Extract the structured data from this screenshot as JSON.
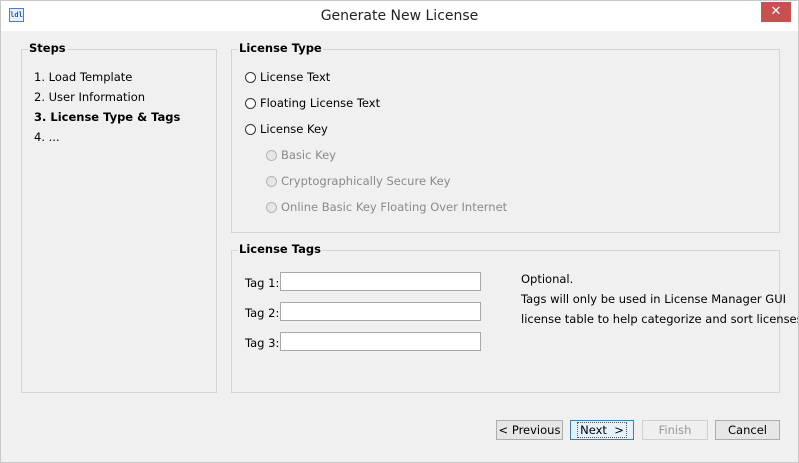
{
  "window": {
    "title": "Generate New License",
    "icon": "app-icon",
    "icon_text": "ldl",
    "close_label": "✕"
  },
  "steps": {
    "title": "Steps",
    "items": [
      "1. Load Template",
      "2. User Information",
      "3. License Type & Tags",
      "4. ..."
    ],
    "active_index": 2
  },
  "license_type": {
    "title": "License Type",
    "options": [
      {
        "label": "License Text",
        "enabled": true,
        "selected": false
      },
      {
        "label": "Floating License Text",
        "enabled": true,
        "selected": false
      },
      {
        "label": "License Key",
        "enabled": true,
        "selected": false
      }
    ],
    "key_options": [
      {
        "label": "Basic Key",
        "enabled": false,
        "selected": false
      },
      {
        "label": "Cryptographically Secure Key",
        "enabled": false,
        "selected": false
      },
      {
        "label": "Online Basic Key Floating Over Internet",
        "enabled": false,
        "selected": false
      }
    ]
  },
  "license_tags": {
    "title": "License Tags",
    "tags": [
      {
        "label": "Tag 1:",
        "value": ""
      },
      {
        "label": "Tag 2:",
        "value": ""
      },
      {
        "label": "Tag 3:",
        "value": ""
      }
    ],
    "note_lines": [
      "Optional.",
      "Tags will only be used in License Manager GUI",
      "license table to help categorize and sort licenses."
    ]
  },
  "buttons": {
    "previous": "< Previous",
    "next": "Next  >",
    "finish": "Finish",
    "cancel": "Cancel",
    "finish_enabled": false
  },
  "colors": {
    "close_button": "#c75050",
    "focus_border": "#3c7fb1",
    "panel_border": "#d5d5d5"
  }
}
